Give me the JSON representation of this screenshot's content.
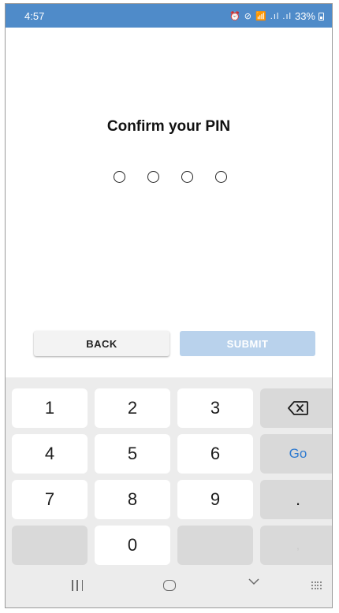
{
  "status_bar": {
    "time": "4:57",
    "icons": "⏰ ⊘ 📶 .ıl .ıl",
    "battery": "33%"
  },
  "pin": {
    "title": "Confirm your PIN",
    "dot_count": 4
  },
  "actions": {
    "back_label": "BACK",
    "submit_label": "SUBMIT"
  },
  "keypad": {
    "row1": [
      "1",
      "2",
      "3"
    ],
    "row2": [
      "4",
      "5",
      "6"
    ],
    "row3": [
      "7",
      "8",
      "9"
    ],
    "zero": "0",
    "go_label": "Go",
    "period": ".",
    "comma": ","
  },
  "colors": {
    "status_bar": "#4f8bc9",
    "submit_disabled": "#b9d2ec",
    "go": "#2f7bd0"
  }
}
